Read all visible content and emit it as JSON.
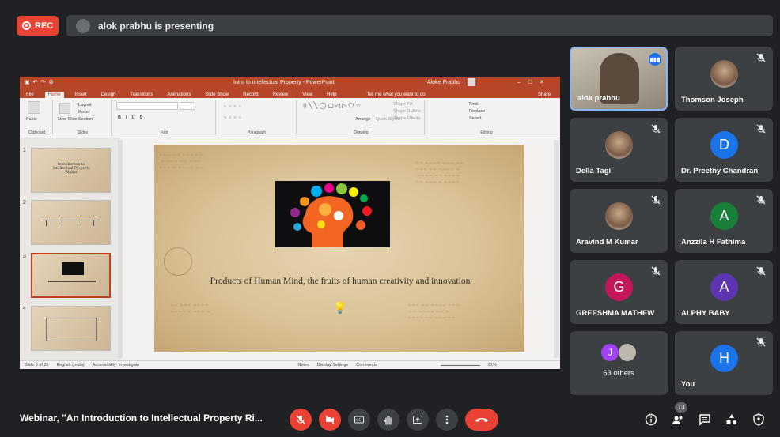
{
  "recording": {
    "label": "REC"
  },
  "presenting_banner": {
    "text": "alok prabhu is presenting"
  },
  "ppt": {
    "title": "Intro to Intellectual Property - PowerPoint",
    "user": "Aloke Prabhu",
    "tabs": [
      "File",
      "Home",
      "Insert",
      "Design",
      "Transitions",
      "Animations",
      "Slide Show",
      "Record",
      "Review",
      "View",
      "Help"
    ],
    "tell_me": "Tell me what you want to do",
    "share": "Share",
    "groups": [
      "Clipboard",
      "Slides",
      "Font",
      "Paragraph",
      "Drawing",
      "Editing"
    ],
    "ribbon": {
      "paste": "Paste",
      "new_slide": "New Slide",
      "layout": "Layout",
      "reset": "Reset",
      "section": "Section",
      "arrange": "Arrange",
      "quick_styles": "Quick Styles",
      "shape_fill": "Shape Fill",
      "shape_outline": "Shape Outline",
      "shape_effects": "Shape Effects",
      "find": "Find",
      "replace": "Replace",
      "select": "Select"
    },
    "slide_numbers": [
      "1",
      "2",
      "3",
      "4"
    ],
    "thumb1_text": "Introduction to Intellectual Property Rights",
    "slide_caption": "Products of Human Mind, the fruits of human creativity and innovation",
    "status": {
      "slide": "Slide 3 of 26",
      "language": "English (India)",
      "accessibility": "Accessibility: Investigate",
      "notes": "Notes",
      "display": "Display Settings",
      "comments": "Comments",
      "zoom": "91%"
    }
  },
  "participants": [
    {
      "name": "alok prabhu",
      "type": "video",
      "speaking": true
    },
    {
      "name": "Thomson Joseph",
      "type": "photo",
      "muted": true
    },
    {
      "name": "Della Tagi",
      "type": "photo",
      "muted": true
    },
    {
      "name": "Dr. Preethy Chandran",
      "initial": "D",
      "color": "#1a73e8",
      "muted": true
    },
    {
      "name": "Aravind M Kumar",
      "type": "photo",
      "muted": true
    },
    {
      "name": "Anzzila H Fathima",
      "initial": "A",
      "color": "#188038",
      "muted": true
    },
    {
      "name": "GREESHMA MATHEW",
      "initial": "G",
      "color": "#c2185b",
      "muted": true
    },
    {
      "name": "ALPHY BABY",
      "initial": "A",
      "color": "#5e35b1",
      "muted": true
    },
    {
      "name": "63 others",
      "initial": "J",
      "color": "#a142f4"
    },
    {
      "name": "You",
      "initial": "H",
      "color": "#1a73e8",
      "muted": true
    }
  ],
  "meeting": {
    "title": "Webinar, \"An Introduction to Intellectual Property Ri...",
    "people_count": "73"
  },
  "icons": {
    "mic": "mic-off-icon",
    "cam": "camera-off-icon",
    "cc": "captions-icon",
    "hand": "raise-hand-icon",
    "present": "present-icon",
    "more": "more-icon",
    "end": "end-call-icon",
    "info": "info-icon",
    "people": "people-icon",
    "chat": "chat-icon",
    "activities": "activities-icon",
    "safety": "host-controls-icon"
  },
  "colors": {
    "accent_red": "#ea4335",
    "ppt_red": "#b7472a",
    "tile_bg": "#3c4043",
    "bg": "#202124"
  }
}
